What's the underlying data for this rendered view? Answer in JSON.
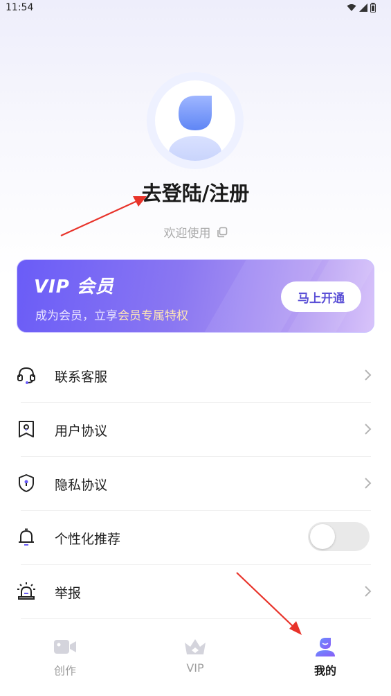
{
  "status_bar": {
    "time": "11:54"
  },
  "profile": {
    "login_title": "去登陆/注册",
    "welcome_text": "欢迎使用"
  },
  "vip_card": {
    "title": "VIP 会员",
    "subtitle_prefix": "成为会员，立享",
    "subtitle_highlight": "会员专属特权",
    "button_label": "马上开通"
  },
  "menu": [
    {
      "label": "联系客服",
      "icon": "headset-icon"
    },
    {
      "label": "用户协议",
      "icon": "agreement-icon"
    },
    {
      "label": "隐私协议",
      "icon": "shield-lock-icon"
    },
    {
      "label": "个性化推荐",
      "icon": "bell-icon",
      "toggle_on": false
    },
    {
      "label": "举报",
      "icon": "alarm-icon"
    }
  ],
  "tabs": [
    {
      "label": "创作",
      "icon": "video-camera-icon",
      "active": false
    },
    {
      "label": "VIP",
      "icon": "crown-icon",
      "active": false
    },
    {
      "label": "我的",
      "icon": "user-icon",
      "active": true
    }
  ],
  "colors": {
    "accent": "#6a5cf7",
    "vip_highlight": "#ffe7b5",
    "annotation_arrow": "#e8332a",
    "tab_inactive": "#9e9e9e"
  }
}
